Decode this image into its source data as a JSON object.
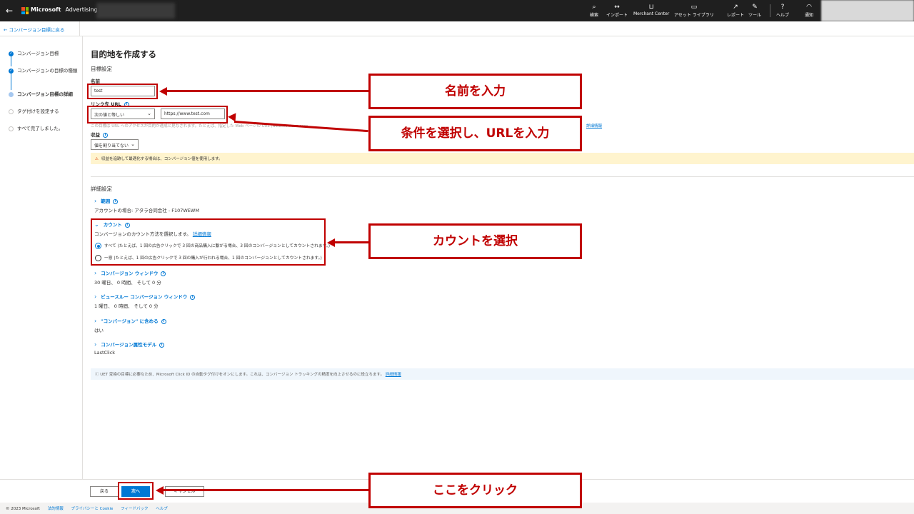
{
  "topbar": {
    "back_icon": "back-arrow-icon",
    "brand": "Microsoft",
    "product": "Advertising",
    "nav": [
      {
        "label": "検索",
        "icon": "search-icon"
      },
      {
        "label": "インポート",
        "icon": "import-icon"
      },
      {
        "label": "Merchant Center",
        "icon": "cart-icon"
      },
      {
        "label": "アセット ライブラリ",
        "icon": "asset-library-icon"
      },
      {
        "label": "レポート",
        "icon": "chart-icon"
      },
      {
        "label": "ツール",
        "icon": "wrench-icon"
      },
      {
        "label": "ヘルプ",
        "icon": "help-icon"
      },
      {
        "label": "通知",
        "icon": "bell-icon"
      }
    ]
  },
  "subbar": {
    "back_link": "← コンバージョン目標に戻る"
  },
  "steps": [
    {
      "label": "コンバージョン目標",
      "state": "done"
    },
    {
      "label": "コンバージョンの目標の種類",
      "state": "done"
    },
    {
      "label": "コンバージョン目標の詳細",
      "state": "current"
    },
    {
      "label": "タグ付けを設定する",
      "state": "todo"
    },
    {
      "label": "すべて完了しました。",
      "state": "todo"
    }
  ],
  "form": {
    "page_title": "目的地を作成する",
    "section_goal": "目標設定",
    "name_label": "名前",
    "name_value": "test",
    "url_label": "リンク先 URL",
    "condition_value": "次の値と等しい",
    "url_value": "https://www.test.com",
    "url_help": "この目標は URL へのアクセスが目的が達成と見なされます。たとえば、指定した Web ページの URL (www.contoso.com...",
    "url_help_link": "詳細情報",
    "revenue_label": "収益",
    "revenue_value": "値を割り当てない",
    "warning": "収益を追跡して最適化する場合は、コンバージョン値を使用します。"
  },
  "advanced": {
    "title": "詳細設定",
    "scope": {
      "title": "範囲",
      "value": "アカウントの場合: アタラ合同会社 - F107WEWM"
    },
    "count": {
      "title": "カウント",
      "desc": "コンバージョンのカウント方法を選択します。",
      "desc_link": "詳細情報",
      "option_all": "すべて (たとえば、1 回の広告クリックで 3 回の商品購入に繋がる場合、3 回のコンバージョンとしてカウントされます。)",
      "option_unique": "一意 (たとえば、1 回の広告クリックで 3 回の購入が行われる場合、1 回のコンバージョンとしてカウントされます。)",
      "selected": "all"
    },
    "conv_window": {
      "title": "コンバージョン ウィンドウ",
      "value": "30 曜日、 0 時間、 そして 0 分"
    },
    "view_through": {
      "title": "ビュースルー コンバージョン ウィンドウ",
      "value": "1 曜日、 0 時間、 そして 0 分"
    },
    "include": {
      "title": "\"コンバージョン\" に含める",
      "value": "はい"
    },
    "attribution": {
      "title": "コンバージョン属性モデル",
      "value": "LastClick"
    },
    "info": "UET 変換の目標に必要なため、Microsoft Click ID の自動タグ付けをオンにします。これは、コンバージョン トラッキングの精度を向上させるのに役立ちます。",
    "info_link": "詳細情報"
  },
  "actions": {
    "back": "戻る",
    "next": "次へ",
    "cancel": "キャンセル"
  },
  "legal": {
    "copyright": "© 2023 Microsoft",
    "links": [
      "法的情報",
      "プライバシーと Cookie",
      "フィードバック",
      "ヘルプ"
    ]
  },
  "callouts": {
    "name": "名前を入力",
    "condition": "条件を選択し、URLを入力",
    "count": "カウントを選択",
    "next": "ここをクリック"
  },
  "colors": {
    "accent": "#0078d4",
    "annotation": "#c00000",
    "topbar": "#1f1f1f",
    "warning": "#fff4ce"
  }
}
